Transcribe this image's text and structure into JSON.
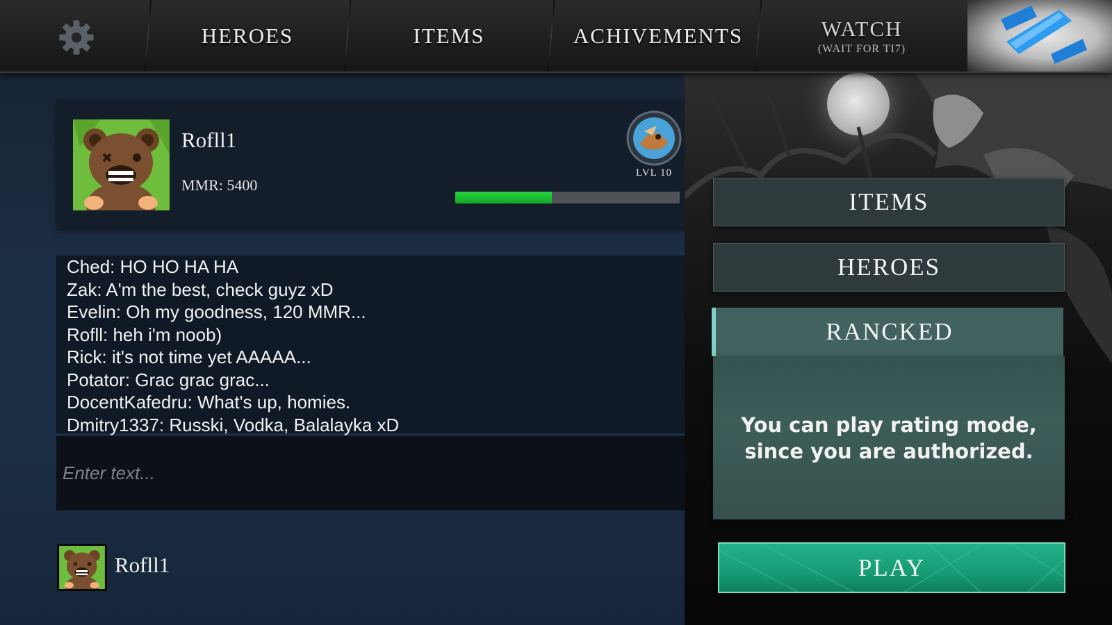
{
  "nav": {
    "settings_icon": "gear-icon",
    "items": [
      {
        "label": "HEROES"
      },
      {
        "label": "ITEMS"
      },
      {
        "label": "ACHIVEMENTS"
      },
      {
        "label": "WATCH",
        "sub": "(WAIT FOR TI7)"
      }
    ],
    "logo_icon": "dota-logo-icon"
  },
  "profile": {
    "name": "Rofll1",
    "mmr": "MMR: 5400",
    "level": "LVL 10",
    "xp_progress": 0.43,
    "avatar_icon": "bear-avatar-icon",
    "level_icon": "hero-badge-icon"
  },
  "chat": {
    "messages": [
      "Ched: HO HO HA HA",
      "Zak: A'm the best, check guyz xD",
      "Evelin: Oh my goodness, 120 MMR...",
      "Rofll: heh i'm noob)",
      "Rick: it's not time yet AAAAA...",
      "Potator: Grac grac grac...",
      "DocentKafedru: What's up, homies.",
      "Dmitry1337: Russki, Vodka, Balalayka xD"
    ],
    "input_placeholder": "Enter text...",
    "current_user": "Rofll1"
  },
  "side_menu": {
    "items_label": "ITEMS",
    "heroes_label": "HEROES",
    "ranked_label": "RANCKED",
    "ranked_text": "You can play rating mode, since you are authorized.",
    "play_label": "PLAY"
  },
  "colors": {
    "accent_green": "#1aa67d",
    "xp_green": "#1fc435",
    "ranked_tab": "#41625e"
  }
}
